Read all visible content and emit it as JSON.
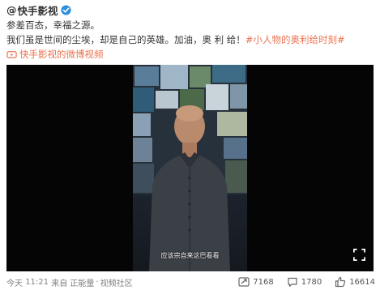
{
  "author": {
    "at": "@",
    "name": "快手影视"
  },
  "post": {
    "line1": "参差百态，幸福之源。",
    "line2_text": "我们虽是世间的尘埃，却是自己的英雄。加油，奥 利 给！",
    "hashtag": "#小人物的奥利给时刻#",
    "source_label": "快手影视的微博视频"
  },
  "video": {
    "subtitle": "应该宗自来这巴看看"
  },
  "meta": {
    "date": "今天",
    "time": "11:21",
    "from_label": "来自",
    "source_app": "正能量",
    "separator": "·",
    "community": "视频社区"
  },
  "actions": {
    "reposts": "7168",
    "comments": "1780",
    "likes": "16614"
  },
  "colors": {
    "link": "#eb7350",
    "verified": "#2c8fde",
    "meta": "#808080"
  },
  "icons": {
    "verified": "verified-badge-icon",
    "source": "video-link-icon",
    "fullscreen": "fullscreen-icon",
    "repost": "repost-icon",
    "comment": "comment-icon",
    "like": "thumbs-up-icon"
  }
}
